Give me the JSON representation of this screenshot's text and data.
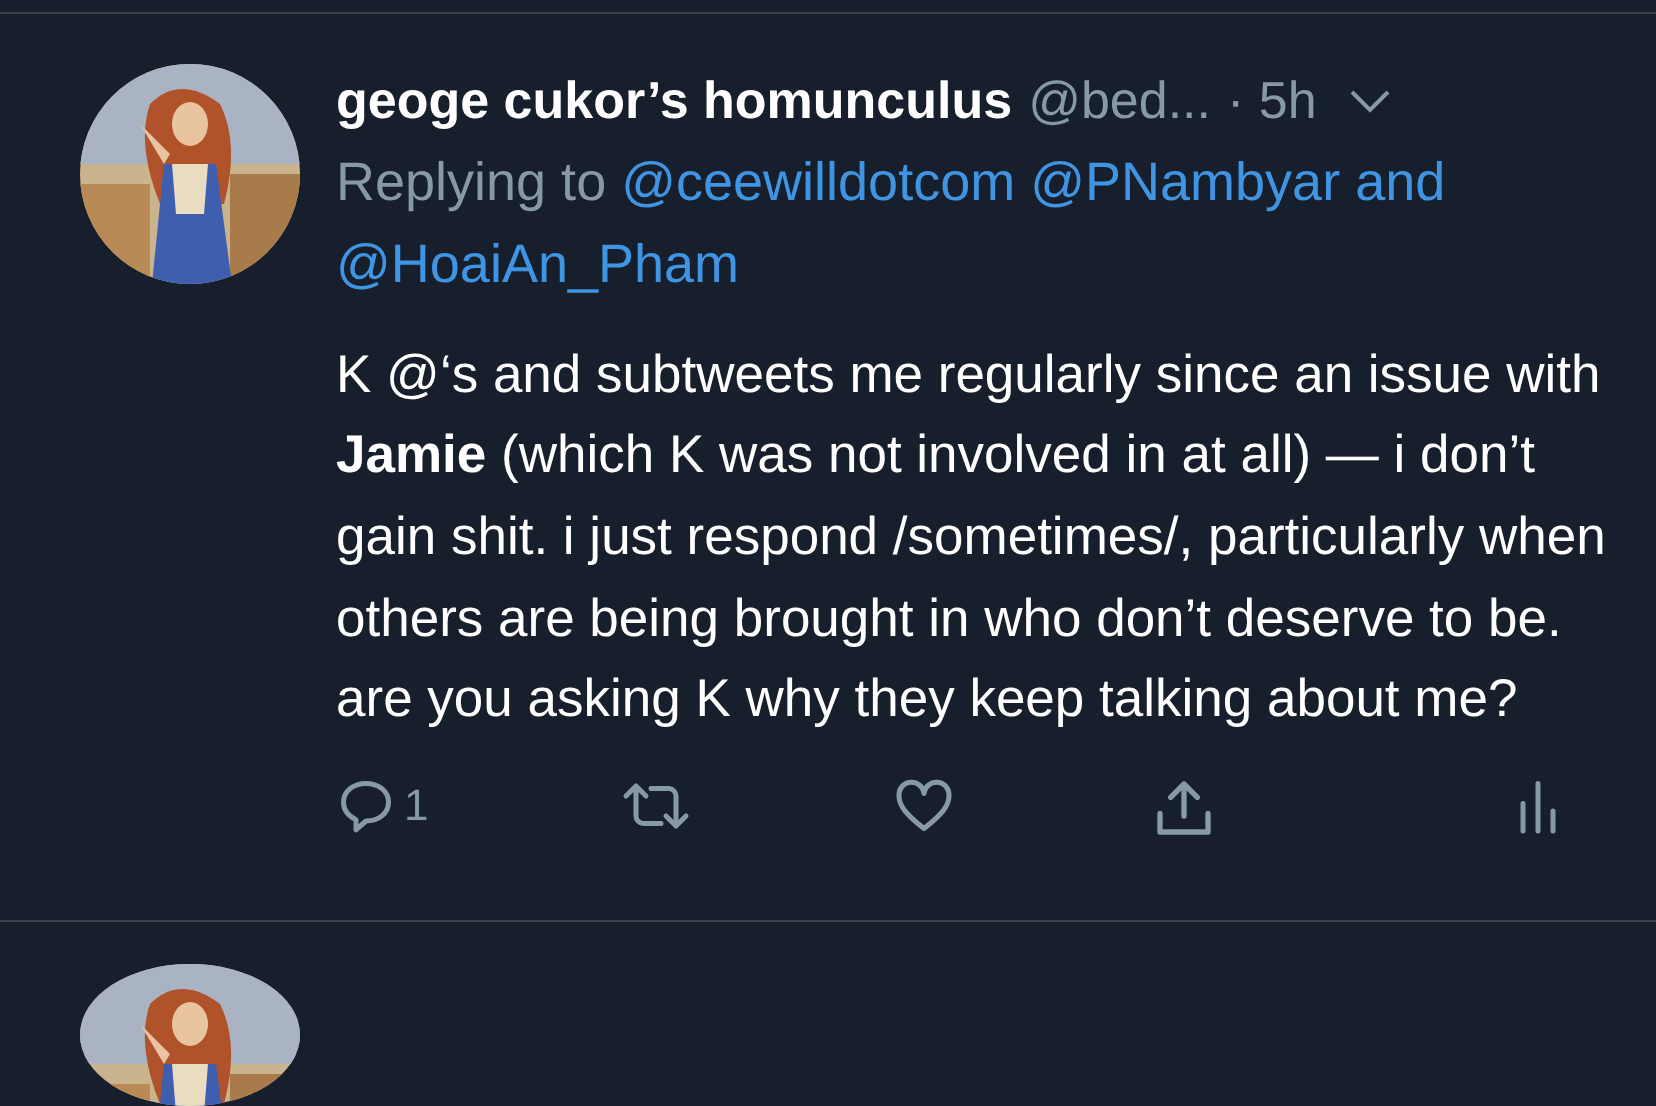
{
  "tweet": {
    "author": {
      "name": "geoge cukor’s homunculus",
      "handle": "@bed...",
      "time": "· 5h"
    },
    "reply_to": {
      "prefix": "Replying to",
      "mentions": [
        "@ceewilldotcom",
        "@PNambyar"
      ],
      "joiner": "and",
      "last": "@HoaiAn_Pham"
    },
    "body": "K @‘s and subtweets me regularly since an issue with **Jamie** (which K was not involved in at all) — i don’t gain shit. i just respond /sometimes/, particularly when others are being brought in who don’t deserve to be. are you asking K why they keep talking about me?",
    "actions": [
      {
        "kind": "reply",
        "count": "1"
      },
      {
        "kind": "retweet"
      },
      {
        "kind": "like"
      },
      {
        "kind": "share"
      },
      {
        "kind": "analytics"
      }
    ]
  }
}
